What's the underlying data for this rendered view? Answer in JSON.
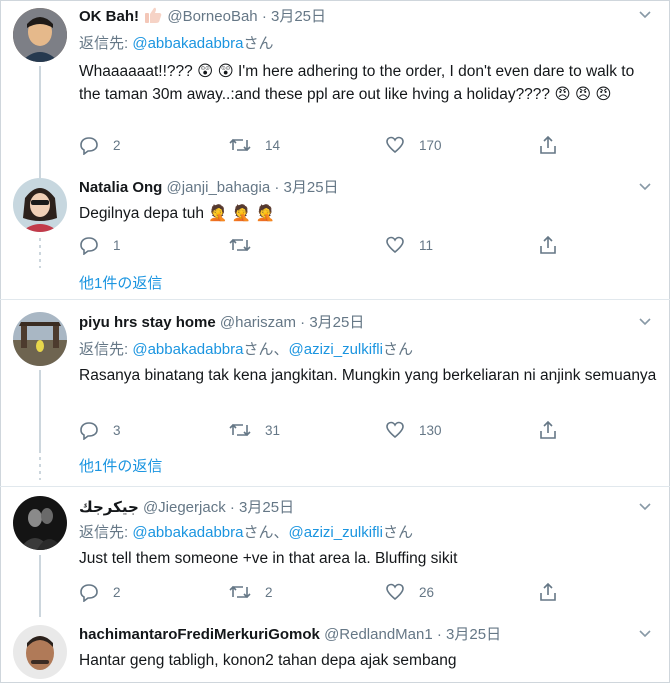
{
  "tweets": [
    {
      "name": "OK Bah!",
      "handle": "@BorneoBah",
      "dot": "·",
      "date": "3月25日",
      "reply_prefix": "返信先:",
      "reply_targets": [
        "@abbakadabbra",
        "さん"
      ],
      "text": "Whaaaaaat!!??? 😲 😲 I'm here adhering to the order, I don't even dare to walk to the taman 30m away..:and these ppl are out like hving a holiday???? 😠 😠 😠",
      "replies": "2",
      "retweets": "14",
      "likes": "170"
    },
    {
      "name": "Natalia Ong",
      "handle": "@janji_bahagia",
      "dot": "·",
      "date": "3月25日",
      "text": "Degilnya depa tuh 🤦 🤦 🤦",
      "replies": "1",
      "retweets": "",
      "likes": "11",
      "more_replies": "他1件の返信"
    },
    {
      "name": "piyu hrs stay home",
      "handle": "@hariszam",
      "dot": "·",
      "date": "3月25日",
      "reply_prefix": "返信先:",
      "reply_targets": [
        "@abbakadabbra",
        "さん、",
        "@azizi_zulkifli",
        "さん"
      ],
      "text": "Rasanya binatang tak kena jangkitan. Mungkin yang berkeliaran ni anjink semuanya",
      "replies": "3",
      "retweets": "31",
      "likes": "130",
      "more_replies": "他1件の返信"
    },
    {
      "name": "جيكرجك",
      "handle": "@Jiegerjack",
      "dot": "·",
      "date": "3月25日",
      "reply_prefix": "返信先:",
      "reply_targets": [
        "@abbakadabbra",
        "さん、",
        "@azizi_zulkifli",
        "さん"
      ],
      "text": "Just tell them someone +ve in that area la. Bluffing sikit",
      "replies": "2",
      "retweets": "2",
      "likes": "26"
    },
    {
      "name": "hachimantaroFrediMerkuriGomok",
      "handle": "@RedlandMan1",
      "dot": "·",
      "date": "3月25日",
      "text": "Hantar geng tabligh, konon2 tahan depa ajak sembang"
    }
  ],
  "colors": {
    "link": "#1b95e0",
    "muted": "#657786",
    "text": "#14171a"
  },
  "icons": [
    "reply-icon",
    "retweet-icon",
    "like-icon",
    "share-icon",
    "chevron-down-icon",
    "thumbs-up-emoji"
  ]
}
